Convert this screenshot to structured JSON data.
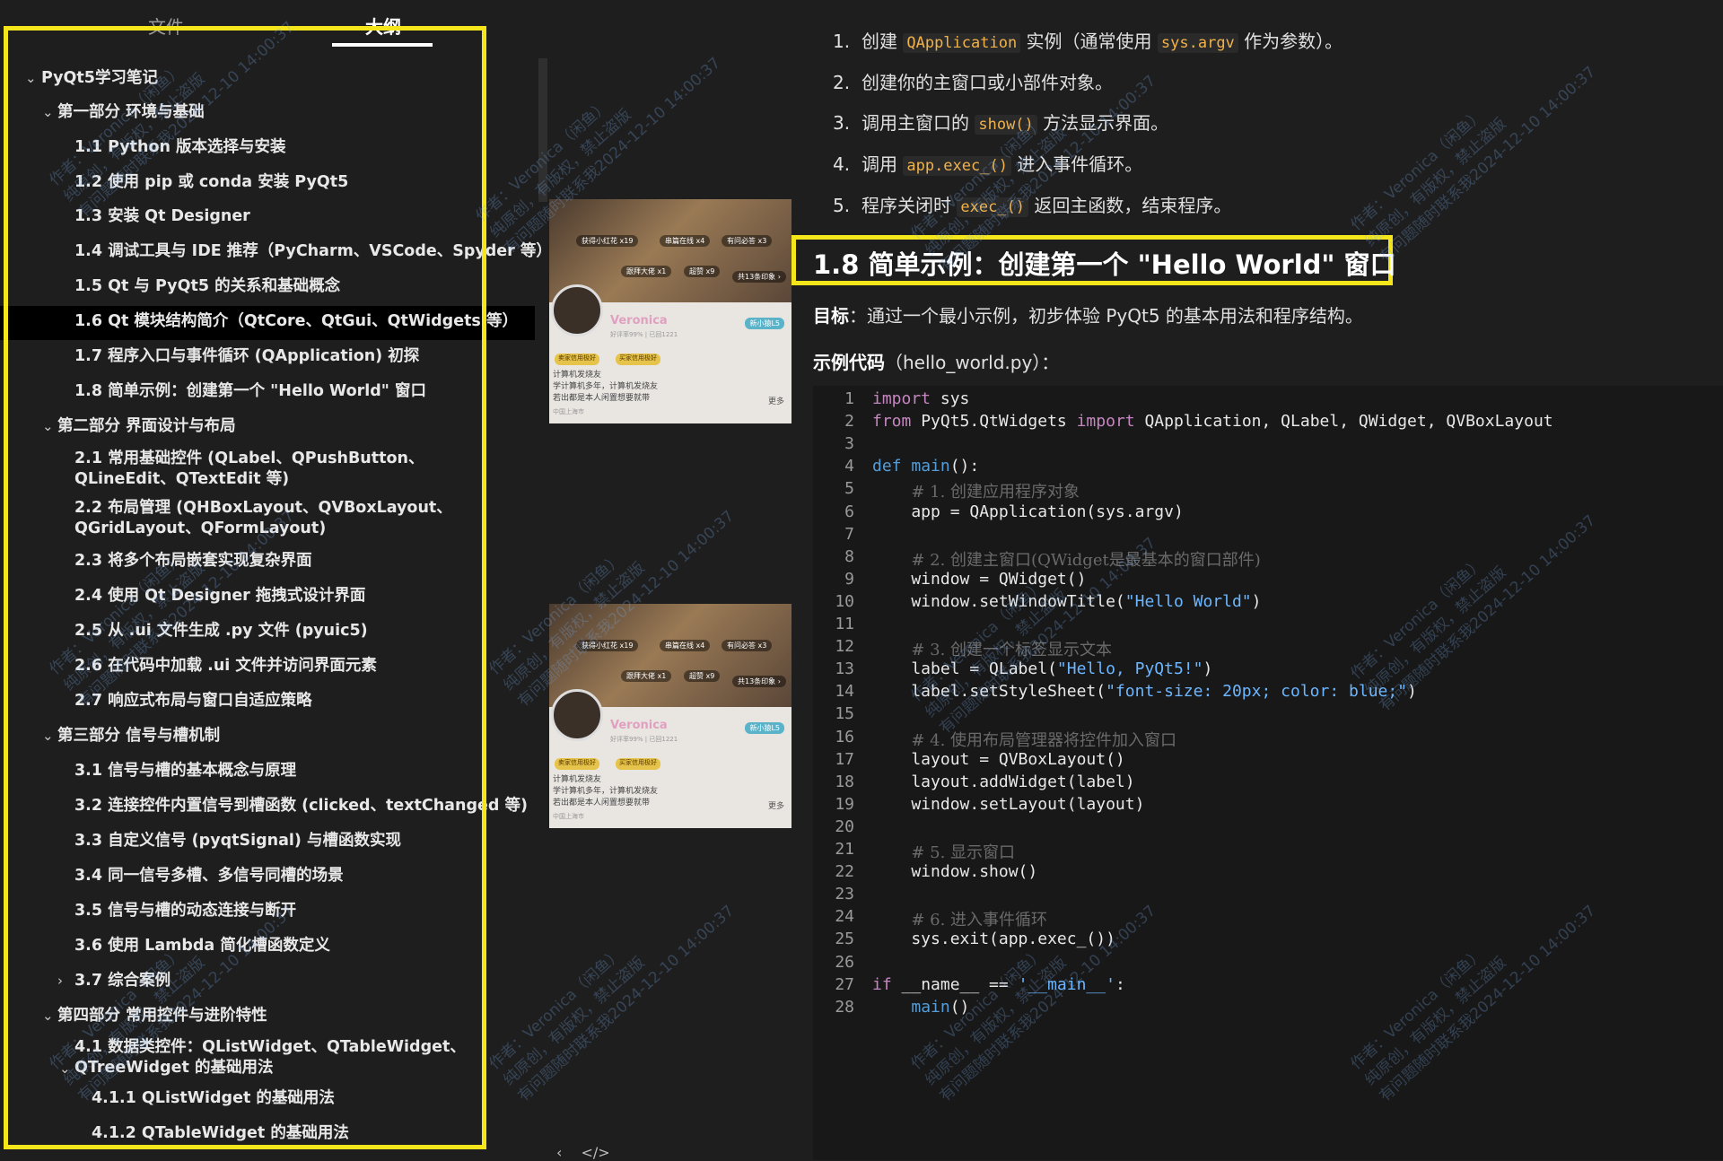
{
  "sidebar": {
    "tabs": [
      {
        "label": "文件"
      },
      {
        "label": "大纲"
      }
    ],
    "outline": [
      {
        "label": "PyQt5学习笔记"
      },
      {
        "label": "第一部分 环境与基础"
      },
      {
        "label": "1.1 Python 版本选择与安装"
      },
      {
        "label": "1.2 使用 pip 或 conda 安装 PyQt5"
      },
      {
        "label": "1.3 安装 Qt Designer"
      },
      {
        "label": "1.4 调试工具与 IDE 推荐（PyCharm、VSCode、Spyder 等）"
      },
      {
        "label": "1.5 Qt 与 PyQt5 的关系和基础概念"
      },
      {
        "label": "1.6 Qt 模块结构简介（QtCore、QtGui、QtWidgets 等）"
      },
      {
        "label": "1.7 程序入口与事件循环 (QApplication) 初探"
      },
      {
        "label": "1.8 简单示例：创建第一个 \"Hello World\" 窗口"
      },
      {
        "label": "第二部分 界面设计与布局"
      },
      {
        "label": "2.1 常用基础控件 (QLabel、QPushButton、QLineEdit、QTextEdit 等)"
      },
      {
        "label": "2.2 布局管理 (QHBoxLayout、QVBoxLayout、QGridLayout、QFormLayout)"
      },
      {
        "label": "2.3 将多个布局嵌套实现复杂界面"
      },
      {
        "label": "2.4 使用 Qt Designer 拖拽式设计界面"
      },
      {
        "label": "2.5 从 .ui 文件生成 .py 文件 (pyuic5)"
      },
      {
        "label": "2.6 在代码中加载 .ui 文件并访问界面元素"
      },
      {
        "label": "2.7 响应式布局与窗口自适应策略"
      },
      {
        "label": "第三部分 信号与槽机制"
      },
      {
        "label": "3.1 信号与槽的基本概念与原理"
      },
      {
        "label": "3.2 连接控件内置信号到槽函数 (clicked、textChanged 等)"
      },
      {
        "label": "3.3 自定义信号 (pyqtSignal) 与槽函数实现"
      },
      {
        "label": "3.4 同一信号多槽、多信号同槽的场景"
      },
      {
        "label": "3.5 信号与槽的动态连接与断开"
      },
      {
        "label": "3.6 使用 Lambda 简化槽函数定义"
      },
      {
        "label": "3.7 综合案例"
      },
      {
        "label": "第四部分 常用控件与进阶特性"
      },
      {
        "label": "4.1 数据类控件：QListWidget、QTableWidget、QTreeWidget 的基础用法"
      },
      {
        "label": "4.1.1 QListWidget 的基础用法"
      },
      {
        "label": "4.1.2 QTableWidget 的基础用法"
      }
    ]
  },
  "thumbnails": {
    "name": "Veronica",
    "pill_1": "获得小红花 x19",
    "pill_2": "串篇在线 x4",
    "pill_3": "有问必答 x3",
    "pill_4": "跟拜大佬 x1",
    "pill_5": "超赞 x9",
    "pill_6": "共13条印象 ›",
    "tag": "新小猿L5",
    "stats": "好评率99% | 已回1221",
    "badge_1": "卖家信用极好",
    "badge_2": "买家信用极好",
    "line_1": "计算机发烧友",
    "line_2": "学计算机多年，计算机发烧友",
    "line_3": "若出都是本人闲置想要就带",
    "line_4": "中国上海市",
    "more": "更多"
  },
  "bottom_nav": {
    "prev": "‹",
    "code": "</>"
  },
  "doc": {
    "steps": [
      {
        "num": "1.",
        "pre": "创建 ",
        "code1": "QApplication",
        "mid": " 实例（通常使用 ",
        "code2": "sys.argv",
        "post": " 作为参数）。"
      },
      {
        "num": "2.",
        "text": "创建你的主窗口或小部件对象。"
      },
      {
        "num": "3.",
        "pre": "调用主窗口的 ",
        "code1": "show()",
        "post": " 方法显示界面。"
      },
      {
        "num": "4.",
        "pre": "调用 ",
        "code1": "app.exec_()",
        "post": " 进入事件循环。"
      },
      {
        "num": "5.",
        "pre": "程序关闭时 ",
        "code1": "exec_()",
        "post": " 返回主函数，结束程序。"
      }
    ],
    "heading": "1.8 简单示例：创建第一个 \"Hello World\" 窗口",
    "goal_label": "目标",
    "goal_text": "：通过一个最小示例，初步体验 PyQt5 的基本用法和程序结构。",
    "example_label": "示例代码",
    "example_text": "（hello_world.py）：",
    "code_lines": [
      "import sys",
      "from PyQt5.QtWidgets import QApplication, QLabel, QWidget, QVBoxLayout",
      "",
      "def main():",
      "    # 1. 创建应用程序对象",
      "    app = QApplication(sys.argv)",
      "",
      "    # 2. 创建主窗口(QWidget是最基本的窗口部件)",
      "    window = QWidget()",
      "    window.setWindowTitle(\"Hello World\")",
      "",
      "    # 3. 创建一个标签显示文本",
      "    label = QLabel(\"Hello, PyQt5!\")",
      "    label.setStyleSheet(\"font-size: 20px; color: blue;\")",
      "",
      "    # 4. 使用布局管理器将控件加入窗口",
      "    layout = QVBoxLayout()",
      "    layout.addWidget(label)",
      "    window.setLayout(layout)",
      "",
      "    # 5. 显示窗口",
      "    window.show()",
      "",
      "    # 6. 进入事件循环",
      "    sys.exit(app.exec_())",
      "",
      "if __name__ == '__main__':",
      "    main()"
    ]
  },
  "watermark": {
    "line1": "作者：Veronica（闲鱼）",
    "line2": "纯原创，有版权，禁止盗版",
    "line3": "有问题随时联系我2024-12-10 14:00:37"
  },
  "colors": {
    "highlight_frame": "#f5e61b",
    "code_keyword": "#c586c0",
    "code_string": "#6cb6ff",
    "inline_code": "#f2b24a"
  }
}
